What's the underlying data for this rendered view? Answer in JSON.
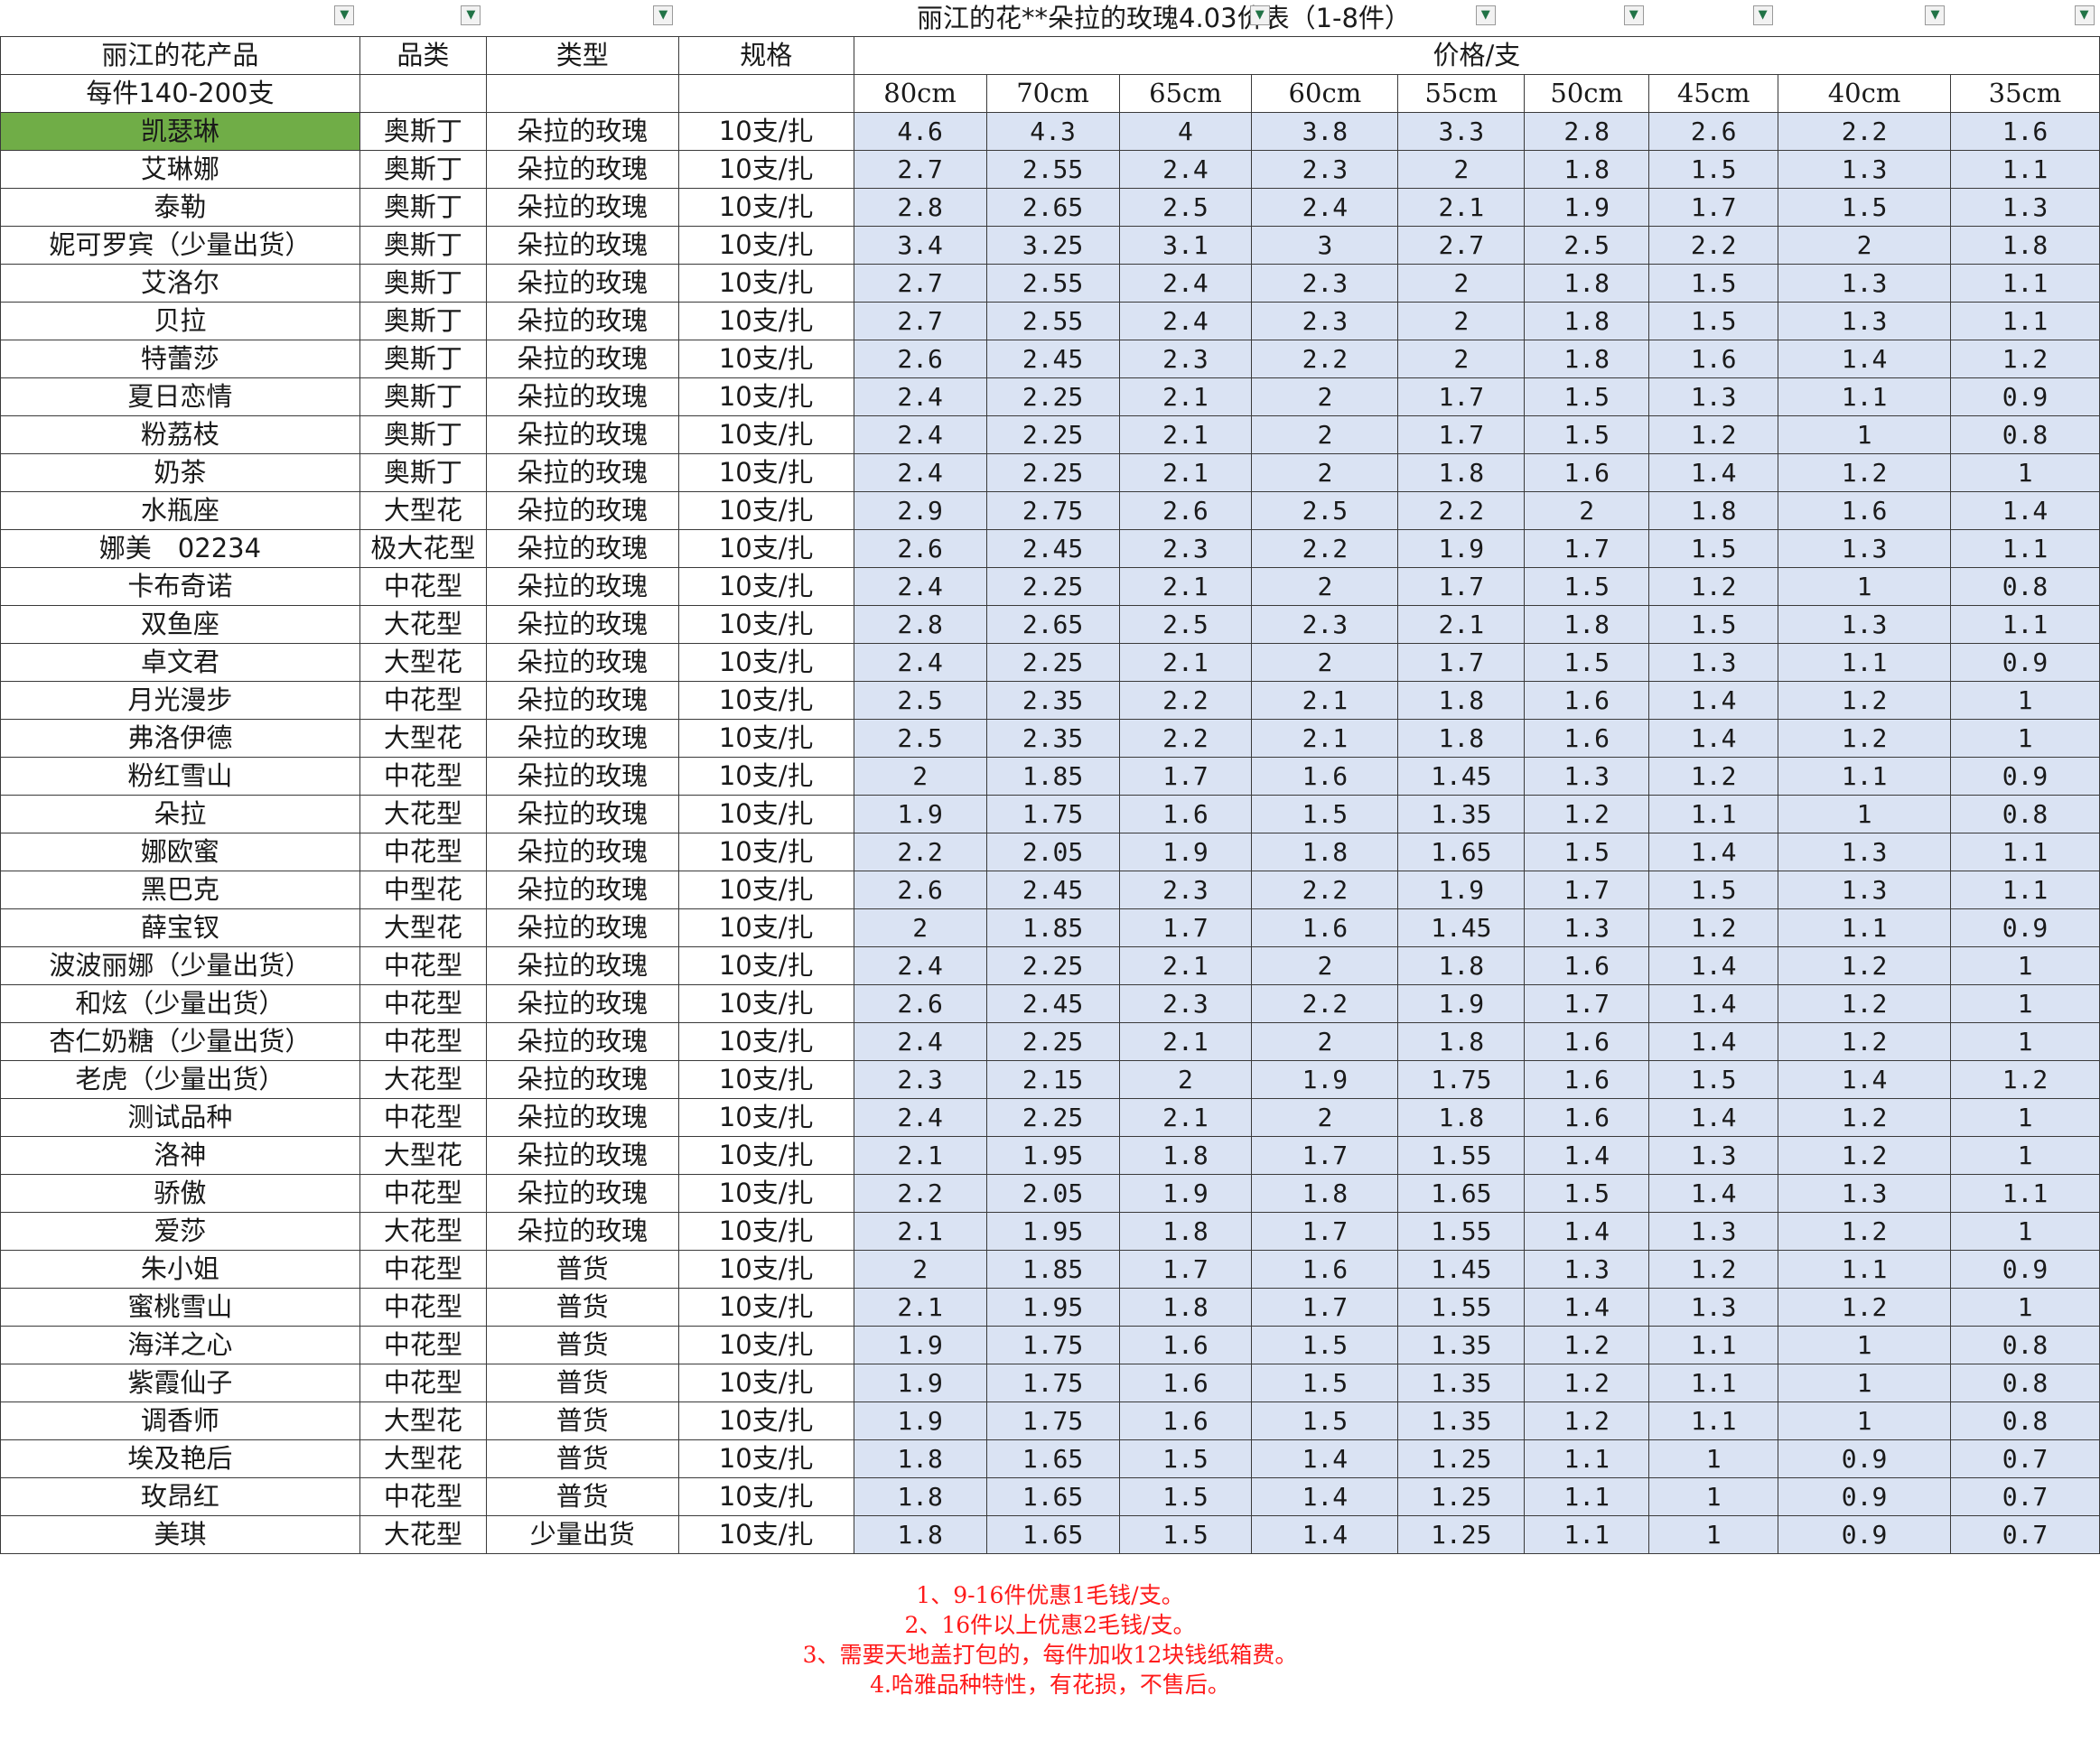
{
  "title": "丽江的花**朵拉的玫瑰4.03价表（1-8件）",
  "headers": {
    "product": "丽江的花产品",
    "category": "品类",
    "type": "类型",
    "spec": "规格",
    "price": "价格/支",
    "per_case": "每件140-200支",
    "sizes": [
      "80cm",
      "70cm",
      "65cm",
      "60cm",
      "55cm",
      "50cm",
      "45cm",
      "40cm",
      "35cm"
    ]
  },
  "filter_icon": "dropdown-arrow-icon",
  "selected_color": "#70ad47",
  "price_fill_color": "#dae3f3",
  "rows": [
    {
      "name": "凯瑟琳",
      "cat": "奥斯丁",
      "type": "朵拉的玫瑰",
      "spec": "10支/扎",
      "prices": [
        "4.6",
        "4.3",
        "4",
        "3.8",
        "3.3",
        "2.8",
        "2.6",
        "2.2",
        "1.6"
      ]
    },
    {
      "name": "艾琳娜",
      "cat": "奥斯丁",
      "type": "朵拉的玫瑰",
      "spec": "10支/扎",
      "prices": [
        "2.7",
        "2.55",
        "2.4",
        "2.3",
        "2",
        "1.8",
        "1.5",
        "1.3",
        "1.1"
      ]
    },
    {
      "name": "泰勒",
      "cat": "奥斯丁",
      "type": "朵拉的玫瑰",
      "spec": "10支/扎",
      "prices": [
        "2.8",
        "2.65",
        "2.5",
        "2.4",
        "2.1",
        "1.9",
        "1.7",
        "1.5",
        "1.3"
      ]
    },
    {
      "name": "妮可罗宾（少量出货）",
      "cat": "奥斯丁",
      "type": "朵拉的玫瑰",
      "spec": "10支/扎",
      "prices": [
        "3.4",
        "3.25",
        "3.1",
        "3",
        "2.7",
        "2.5",
        "2.2",
        "2",
        "1.8"
      ]
    },
    {
      "name": "艾洛尔",
      "cat": "奥斯丁",
      "type": "朵拉的玫瑰",
      "spec": "10支/扎",
      "prices": [
        "2.7",
        "2.55",
        "2.4",
        "2.3",
        "2",
        "1.8",
        "1.5",
        "1.3",
        "1.1"
      ]
    },
    {
      "name": "贝拉",
      "cat": "奥斯丁",
      "type": "朵拉的玫瑰",
      "spec": "10支/扎",
      "prices": [
        "2.7",
        "2.55",
        "2.4",
        "2.3",
        "2",
        "1.8",
        "1.5",
        "1.3",
        "1.1"
      ]
    },
    {
      "name": "特蕾莎",
      "cat": "奥斯丁",
      "type": "朵拉的玫瑰",
      "spec": "10支/扎",
      "prices": [
        "2.6",
        "2.45",
        "2.3",
        "2.2",
        "2",
        "1.8",
        "1.6",
        "1.4",
        "1.2"
      ]
    },
    {
      "name": "夏日恋情",
      "cat": "奥斯丁",
      "type": "朵拉的玫瑰",
      "spec": "10支/扎",
      "prices": [
        "2.4",
        "2.25",
        "2.1",
        "2",
        "1.7",
        "1.5",
        "1.3",
        "1.1",
        "0.9"
      ]
    },
    {
      "name": "粉荔枝",
      "cat": "奥斯丁",
      "type": "朵拉的玫瑰",
      "spec": "10支/扎",
      "prices": [
        "2.4",
        "2.25",
        "2.1",
        "2",
        "1.7",
        "1.5",
        "1.2",
        "1",
        "0.8"
      ]
    },
    {
      "name": "奶茶",
      "cat": "奥斯丁",
      "type": "朵拉的玫瑰",
      "spec": "10支/扎",
      "prices": [
        "2.4",
        "2.25",
        "2.1",
        "2",
        "1.8",
        "1.6",
        "1.4",
        "1.2",
        "1"
      ]
    },
    {
      "name": "水瓶座",
      "cat": "大型花",
      "type": "朵拉的玫瑰",
      "spec": "10支/扎",
      "prices": [
        "2.9",
        "2.75",
        "2.6",
        "2.5",
        "2.2",
        "2",
        "1.8",
        "1.6",
        "1.4"
      ]
    },
    {
      "name": "娜美　02234",
      "cat": "极大花型",
      "type": "朵拉的玫瑰",
      "spec": "10支/扎",
      "prices": [
        "2.6",
        "2.45",
        "2.3",
        "2.2",
        "1.9",
        "1.7",
        "1.5",
        "1.3",
        "1.1"
      ]
    },
    {
      "name": "卡布奇诺",
      "cat": "中花型",
      "type": "朵拉的玫瑰",
      "spec": "10支/扎",
      "prices": [
        "2.4",
        "2.25",
        "2.1",
        "2",
        "1.7",
        "1.5",
        "1.2",
        "1",
        "0.8"
      ]
    },
    {
      "name": "双鱼座",
      "cat": "大花型",
      "type": "朵拉的玫瑰",
      "spec": "10支/扎",
      "prices": [
        "2.8",
        "2.65",
        "2.5",
        "2.3",
        "2.1",
        "1.8",
        "1.5",
        "1.3",
        "1.1"
      ]
    },
    {
      "name": "卓文君",
      "cat": "大型花",
      "type": "朵拉的玫瑰",
      "spec": "10支/扎",
      "prices": [
        "2.4",
        "2.25",
        "2.1",
        "2",
        "1.7",
        "1.5",
        "1.3",
        "1.1",
        "0.9"
      ]
    },
    {
      "name": "月光漫步",
      "cat": "中花型",
      "type": "朵拉的玫瑰",
      "spec": "10支/扎",
      "prices": [
        "2.5",
        "2.35",
        "2.2",
        "2.1",
        "1.8",
        "1.6",
        "1.4",
        "1.2",
        "1"
      ]
    },
    {
      "name": "弗洛伊德",
      "cat": "大型花",
      "type": "朵拉的玫瑰",
      "spec": "10支/扎",
      "prices": [
        "2.5",
        "2.35",
        "2.2",
        "2.1",
        "1.8",
        "1.6",
        "1.4",
        "1.2",
        "1"
      ]
    },
    {
      "name": "粉红雪山",
      "cat": "中花型",
      "type": "朵拉的玫瑰",
      "spec": "10支/扎",
      "prices": [
        "2",
        "1.85",
        "1.7",
        "1.6",
        "1.45",
        "1.3",
        "1.2",
        "1.1",
        "0.9"
      ]
    },
    {
      "name": "朵拉",
      "cat": "大花型",
      "type": "朵拉的玫瑰",
      "spec": "10支/扎",
      "prices": [
        "1.9",
        "1.75",
        "1.6",
        "1.5",
        "1.35",
        "1.2",
        "1.1",
        "1",
        "0.8"
      ]
    },
    {
      "name": "娜欧蜜",
      "cat": "中花型",
      "type": "朵拉的玫瑰",
      "spec": "10支/扎",
      "prices": [
        "2.2",
        "2.05",
        "1.9",
        "1.8",
        "1.65",
        "1.5",
        "1.4",
        "1.3",
        "1.1"
      ]
    },
    {
      "name": "黑巴克",
      "cat": "中型花",
      "type": "朵拉的玫瑰",
      "spec": "10支/扎",
      "prices": [
        "2.6",
        "2.45",
        "2.3",
        "2.2",
        "1.9",
        "1.7",
        "1.5",
        "1.3",
        "1.1"
      ]
    },
    {
      "name": "薛宝钗",
      "cat": "大型花",
      "type": "朵拉的玫瑰",
      "spec": "10支/扎",
      "prices": [
        "2",
        "1.85",
        "1.7",
        "1.6",
        "1.45",
        "1.3",
        "1.2",
        "1.1",
        "0.9"
      ]
    },
    {
      "name": "波波丽娜（少量出货）",
      "cat": "中花型",
      "type": "朵拉的玫瑰",
      "spec": "10支/扎",
      "prices": [
        "2.4",
        "2.25",
        "2.1",
        "2",
        "1.8",
        "1.6",
        "1.4",
        "1.2",
        "1"
      ]
    },
    {
      "name": "和炫（少量出货）",
      "cat": "中花型",
      "type": "朵拉的玫瑰",
      "spec": "10支/扎",
      "prices": [
        "2.6",
        "2.45",
        "2.3",
        "2.2",
        "1.9",
        "1.7",
        "1.4",
        "1.2",
        "1"
      ]
    },
    {
      "name": "杏仁奶糖（少量出货）",
      "cat": "中花型",
      "type": "朵拉的玫瑰",
      "spec": "10支/扎",
      "prices": [
        "2.4",
        "2.25",
        "2.1",
        "2",
        "1.8",
        "1.6",
        "1.4",
        "1.2",
        "1"
      ]
    },
    {
      "name": "老虎（少量出货）",
      "cat": "大花型",
      "type": "朵拉的玫瑰",
      "spec": "10支/扎",
      "prices": [
        "2.3",
        "2.15",
        "2",
        "1.9",
        "1.75",
        "1.6",
        "1.5",
        "1.4",
        "1.2"
      ]
    },
    {
      "name": "测试品种",
      "cat": "中花型",
      "type": "朵拉的玫瑰",
      "spec": "10支/扎",
      "prices": [
        "2.4",
        "2.25",
        "2.1",
        "2",
        "1.8",
        "1.6",
        "1.4",
        "1.2",
        "1"
      ]
    },
    {
      "name": "洛神",
      "cat": "大型花",
      "type": "朵拉的玫瑰",
      "spec": "10支/扎",
      "prices": [
        "2.1",
        "1.95",
        "1.8",
        "1.7",
        "1.55",
        "1.4",
        "1.3",
        "1.2",
        "1"
      ]
    },
    {
      "name": "骄傲",
      "cat": "中花型",
      "type": "朵拉的玫瑰",
      "spec": "10支/扎",
      "prices": [
        "2.2",
        "2.05",
        "1.9",
        "1.8",
        "1.65",
        "1.5",
        "1.4",
        "1.3",
        "1.1"
      ]
    },
    {
      "name": "爱莎",
      "cat": "大花型",
      "type": "朵拉的玫瑰",
      "spec": "10支/扎",
      "prices": [
        "2.1",
        "1.95",
        "1.8",
        "1.7",
        "1.55",
        "1.4",
        "1.3",
        "1.2",
        "1"
      ]
    },
    {
      "name": "朱小姐",
      "cat": "中花型",
      "type": "普货",
      "spec": "10支/扎",
      "prices": [
        "2",
        "1.85",
        "1.7",
        "1.6",
        "1.45",
        "1.3",
        "1.2",
        "1.1",
        "0.9"
      ]
    },
    {
      "name": "蜜桃雪山",
      "cat": "中花型",
      "type": "普货",
      "spec": "10支/扎",
      "prices": [
        "2.1",
        "1.95",
        "1.8",
        "1.7",
        "1.55",
        "1.4",
        "1.3",
        "1.2",
        "1"
      ]
    },
    {
      "name": "海洋之心",
      "cat": "中花型",
      "type": "普货",
      "spec": "10支/扎",
      "prices": [
        "1.9",
        "1.75",
        "1.6",
        "1.5",
        "1.35",
        "1.2",
        "1.1",
        "1",
        "0.8"
      ]
    },
    {
      "name": "紫霞仙子",
      "cat": "中花型",
      "type": "普货",
      "spec": "10支/扎",
      "prices": [
        "1.9",
        "1.75",
        "1.6",
        "1.5",
        "1.35",
        "1.2",
        "1.1",
        "1",
        "0.8"
      ]
    },
    {
      "name": "调香师",
      "cat": "大型花",
      "type": "普货",
      "spec": "10支/扎",
      "prices": [
        "1.9",
        "1.75",
        "1.6",
        "1.5",
        "1.35",
        "1.2",
        "1.1",
        "1",
        "0.8"
      ]
    },
    {
      "name": "埃及艳后",
      "cat": "大型花",
      "type": "普货",
      "spec": "10支/扎",
      "prices": [
        "1.8",
        "1.65",
        "1.5",
        "1.4",
        "1.25",
        "1.1",
        "1",
        "0.9",
        "0.7"
      ]
    },
    {
      "name": "玫昂红",
      "cat": "中花型",
      "type": "普货",
      "spec": "10支/扎",
      "prices": [
        "1.8",
        "1.65",
        "1.5",
        "1.4",
        "1.25",
        "1.1",
        "1",
        "0.9",
        "0.7"
      ]
    },
    {
      "name": "美琪",
      "cat": "大花型",
      "type": "少量出货",
      "spec": "10支/扎",
      "prices": [
        "1.8",
        "1.65",
        "1.5",
        "1.4",
        "1.25",
        "1.1",
        "1",
        "0.9",
        "0.7"
      ]
    }
  ],
  "notes": [
    "1、9-16件优惠1毛钱/支。",
    "2、16件以上优惠2毛钱/支。",
    "3、需要天地盖打包的，每件加收12块钱纸箱费。",
    "4.哈雅品种特性，有花损，不售后。"
  ]
}
